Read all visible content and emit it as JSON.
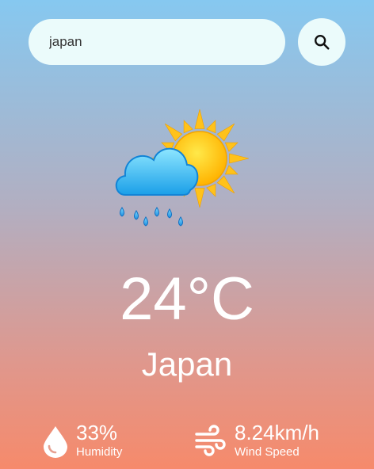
{
  "search": {
    "value": "japan",
    "icon": "search-icon"
  },
  "weather": {
    "icon": "rain-sun-icon",
    "temperature": "24°C",
    "city": "Japan"
  },
  "humidity": {
    "value": "33%",
    "label": "Humidity",
    "icon": "water-drop-icon"
  },
  "wind": {
    "value": "8.24km/h",
    "label": "Wind Speed",
    "icon": "wind-icon"
  },
  "colors": {
    "gradient_top": "#86c8f0",
    "gradient_bottom": "#f68a6b",
    "search_bg": "#ebfbfb",
    "text": "#ffffff"
  }
}
